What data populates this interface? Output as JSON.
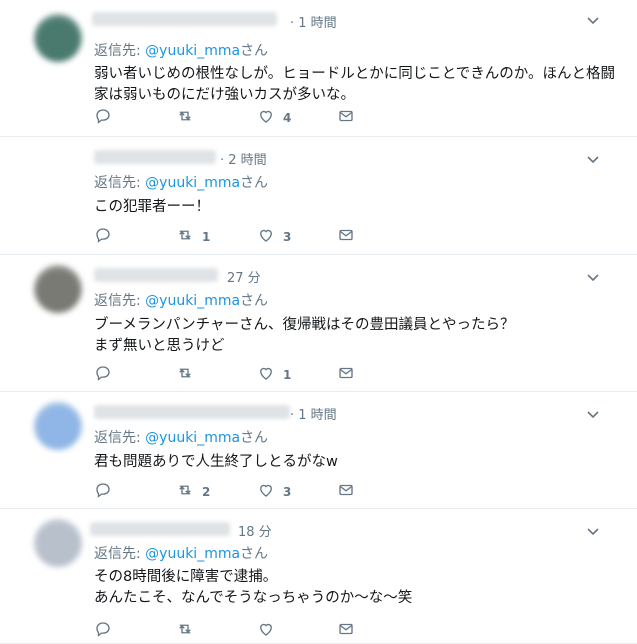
{
  "tweets": [
    {
      "time": "· 1 時間",
      "reply_prefix": "返信先: ",
      "handle": "@yuuki_mma",
      "reply_suffix": "さん",
      "text": "弱い者いじめの根性なしが。ヒョードルとかに同じことできんのか。ほんと格闘\n家は弱いものにだけ強いカスが多いな。",
      "replies": "",
      "retweets": "",
      "likes": "4",
      "avatar_color": "#4a7a6e"
    },
    {
      "time": "· 2 時間",
      "reply_prefix": "返信先: ",
      "handle": "@yuuki_mma",
      "reply_suffix": "さん",
      "text": "この犯罪者ーー！",
      "replies": "",
      "retweets": "1",
      "likes": "3",
      "avatar_color": "#ffffff"
    },
    {
      "time": "27 分",
      "reply_prefix": "返信先: ",
      "handle": "@yuuki_mma",
      "reply_suffix": "さん",
      "text": "ブーメランパンチャーさん、復帰戦はその豊田議員とやったら？\nまず無いと思うけど",
      "replies": "",
      "retweets": "",
      "likes": "1",
      "avatar_color": "#7a7a74"
    },
    {
      "time": "· 1 時間",
      "reply_prefix": "返信先: ",
      "handle": "@yuuki_mma",
      "reply_suffix": "さん",
      "text": "君も問題ありで人生終了しとるがなw",
      "replies": "",
      "retweets": "2",
      "likes": "3",
      "avatar_color": "#8fb6e6"
    },
    {
      "time": "18 分",
      "reply_prefix": "返信先: ",
      "handle": "@yuuki_mma",
      "reply_suffix": "さん",
      "text": "その8時間後に障害で逮捕。\nあんたこそ、なんでそうなっちゃうのか〜な〜笑",
      "replies": "",
      "retweets": "",
      "likes": "",
      "avatar_color": "#b8c0cc"
    }
  ],
  "colors": {
    "handle": "#1b95e0",
    "meta": "#657786",
    "divider": "#e6ecf0"
  }
}
